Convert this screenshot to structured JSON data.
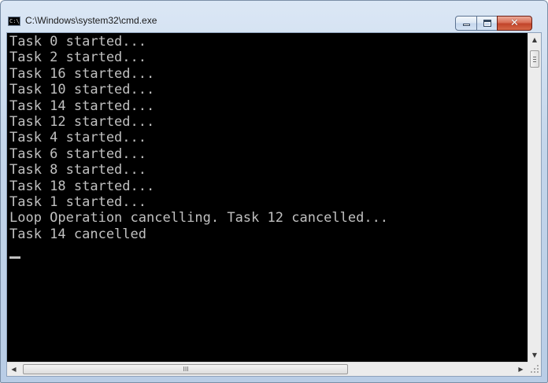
{
  "window": {
    "title": "C:\\Windows\\system32\\cmd.exe",
    "icon_label": "C:\\",
    "controls": {
      "minimize_icon": "minimize-icon",
      "maximize_icon": "maximize-icon",
      "close_icon": "close-icon",
      "close_glyph": "✕"
    }
  },
  "console": {
    "lines": [
      "Task 0 started...",
      "Task 2 started...",
      "Task 16 started...",
      "Task 10 started...",
      "Task 14 started...",
      "Task 12 started...",
      "Task 4 started...",
      "Task 6 started...",
      "Task 8 started...",
      "Task 18 started...",
      "Task 1 started...",
      "Loop Operation cancelling. Task 12 cancelled...",
      "Task 14 cancelled"
    ],
    "background": "#000000",
    "foreground": "#c0c0c0"
  },
  "scrollbars": {
    "up_arrow": "▲",
    "down_arrow": "▼",
    "left_arrow": "◀",
    "right_arrow": "▶",
    "h_grip": "III"
  },
  "colors": {
    "close_button": "#c1442a",
    "frame": "#c3d5ea"
  }
}
